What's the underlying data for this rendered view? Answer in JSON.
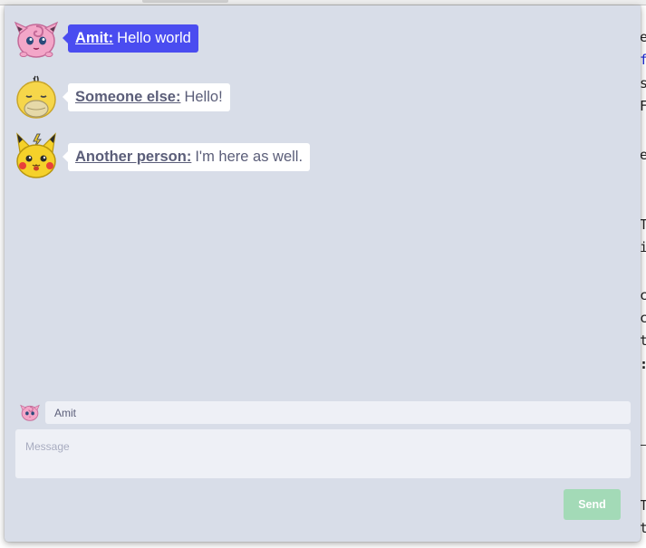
{
  "messages": [
    {
      "author": "Amit:",
      "text": "Hello world",
      "avatar": "jigglypuff-icon",
      "self": true
    },
    {
      "author": "Someone else:",
      "text": "Hello!",
      "avatar": "psyduck-icon",
      "self": false
    },
    {
      "author": "Another person:",
      "text": "I'm here as well.",
      "avatar": "pikachu-icon",
      "self": false
    }
  ],
  "composer": {
    "name_value": "Amit",
    "name_avatar": "jigglypuff-icon",
    "message_placeholder": "Message",
    "send_label": "Send"
  },
  "background_text": {
    "lines": [
      "e",
      "f",
      "s",
      "F",
      "",
      "e",
      "",
      "T",
      "i",
      "",
      "c",
      "c",
      "t",
      ":",
      "",
      "",
      "",
      "T",
      "t"
    ]
  },
  "colors": {
    "chat_bg": "#d8dde8",
    "self_bubble": "#4a4cf0",
    "other_bubble": "#ffffff",
    "send_button": "#a3dab7"
  }
}
